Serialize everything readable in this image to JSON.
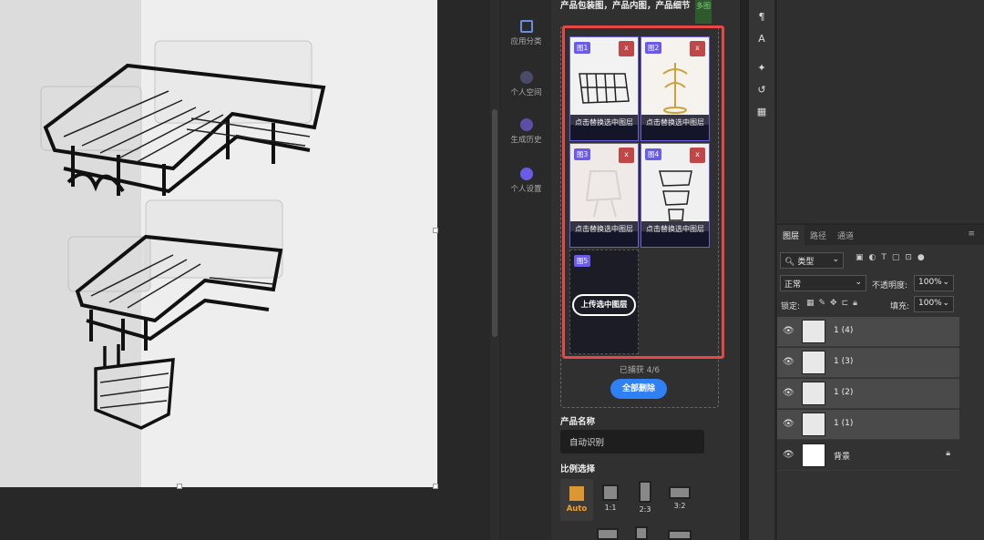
{
  "plugin": {
    "nav": [
      {
        "label": "应用分类",
        "icon": "grid-icon"
      },
      {
        "label": "个人空间",
        "icon": "person-icon"
      },
      {
        "label": "生成历史",
        "icon": "history-icon"
      },
      {
        "label": "个人设置",
        "icon": "settings-icon"
      }
    ],
    "upload_title": "产品包装图，产品内图，产品细节",
    "multi_badge": "多图",
    "tiles": [
      {
        "tag": "图1",
        "close": "x",
        "caption": "点击替换选中图层"
      },
      {
        "tag": "图2",
        "close": "x",
        "caption": "点击替换选中图层"
      },
      {
        "tag": "图3",
        "close": "x",
        "caption": "点击替换选中图层"
      },
      {
        "tag": "图4",
        "close": "x",
        "caption": "点击替换选中图层"
      }
    ],
    "empty_tile": {
      "tag": "图5",
      "button": "上传选中图层"
    },
    "captured": "已捕获 4/6",
    "delete_all": "全部删除",
    "product_name_label": "产品名称",
    "product_name_value": "自动识别",
    "ratio_label": "比例选择",
    "ratios": [
      "Auto",
      "1:1",
      "2:3",
      "3:2"
    ]
  },
  "layers_panel": {
    "tabs": [
      "图层",
      "路径",
      "通道"
    ],
    "filter": "类型",
    "blend_mode": "正常",
    "opacity_label": "不透明度:",
    "opacity_value": "100%",
    "lock_label": "锁定:",
    "fill_label": "填充:",
    "fill_value": "100%",
    "layers": [
      "1 (4)",
      "1 (3)",
      "1 (2)",
      "1 (1)"
    ],
    "background": "背景"
  },
  "colors": {
    "accent_purple": "#6b5ce7",
    "highlight_red": "#e64848",
    "button_blue": "#2f7ff5",
    "auto_orange": "#f0a030"
  }
}
